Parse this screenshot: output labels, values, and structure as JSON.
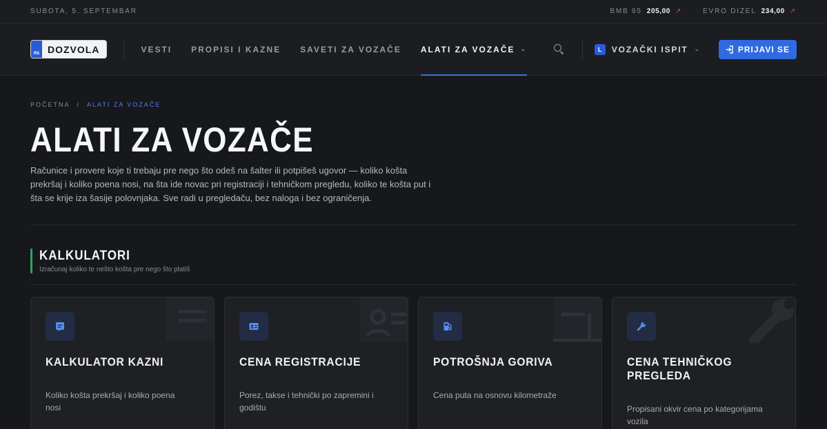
{
  "topbar": {
    "date": "SUBOTA, 5. SEPTEMBAR",
    "fuel": [
      {
        "label": "BMB 95",
        "price": "205,00",
        "trend_icon": "trend-up-icon"
      },
      {
        "label": "EVRO DIZEL",
        "price": "234,00",
        "trend_icon": "trend-up-icon"
      }
    ]
  },
  "nav": {
    "logo_badge": "RS",
    "logo_text": "DOZVOLA",
    "links": [
      "VESTI",
      "PROPISI I KAZNE",
      "SAVETI ZA VOZAČE",
      "ALATI ZA VOZAČE"
    ],
    "active_link": "ALATI ZA VOZAČE",
    "exam_badge": "L",
    "exam_label": "VOZAČKI ISPIT",
    "login_label": "PRIJAVI SE"
  },
  "breadcrumb": {
    "home": "POČETNA",
    "separator": "/",
    "current": "ALATI ZA VOZAČE"
  },
  "page": {
    "title": "ALATI ZA VOZAČE",
    "intro": "Računice i provere koje ti trebaju pre nego što odeš na šalter ili potpišeš ugovor — koliko košta prekršaj i koliko poena nosi, na šta ide novac pri registraciji i tehničkom pregledu, koliko te košta put i šta se krije iza šasije polovnjaka. Sve radi u pregledaču, bez naloga i bez ograničenja."
  },
  "section": {
    "title": "KALKULATORI",
    "subtitle": "Izračunaj koliko te nešto košta pre nego što platiš",
    "accent": "#2fa465"
  },
  "cards": [
    {
      "icon": "ticket-icon",
      "title": "KALKULATOR KAZNI",
      "desc": "Koliko košta prekršaj i koliko poena nosi"
    },
    {
      "icon": "id-card-icon",
      "title": "CENA REGISTRACIJE",
      "desc": "Porez, takse i tehnički po zapremini i godištu"
    },
    {
      "icon": "fuel-pump-icon",
      "title": "POTROŠNJA GORIVA",
      "desc": "Cena puta na osnovu kilometraže"
    },
    {
      "icon": "wrench-icon",
      "title": "CENA TEHNIČKOG PREGLEDA",
      "desc": "Propisani okvir cena po kategorijama vozila"
    }
  ],
  "colors": {
    "accent_blue": "#2f6ae0",
    "trend_red": "#d9463c",
    "background": "#17181c"
  }
}
